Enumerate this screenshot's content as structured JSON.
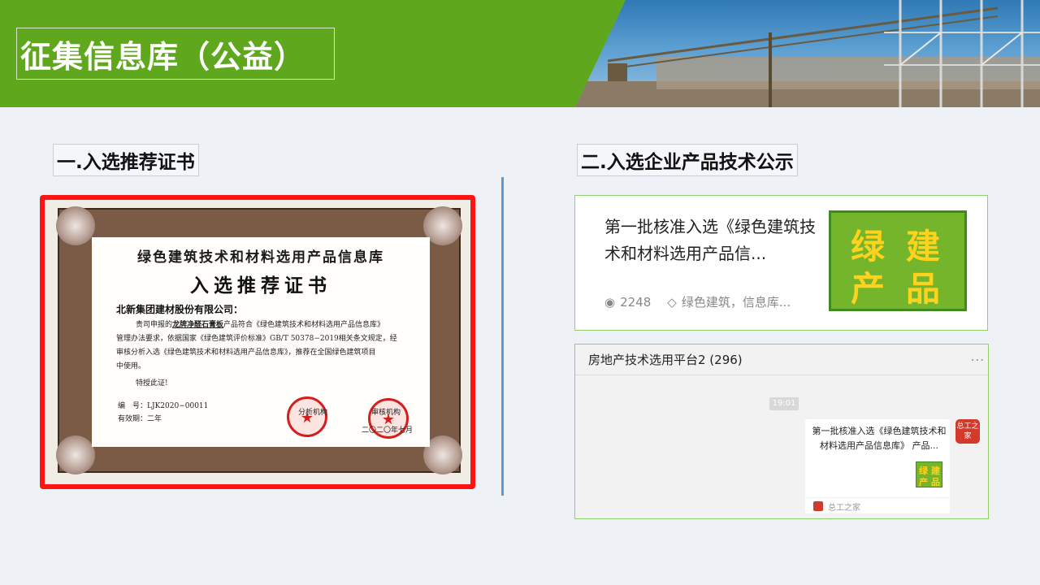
{
  "page": {
    "title": "征集信息库（公益）"
  },
  "sections": {
    "left_label": "一.入选推荐证书",
    "right_label": "二.入选企业产品技术公示"
  },
  "certificate": {
    "heading": "绿色建筑技术和材料选用产品信息库",
    "subheading": "入选推荐证书",
    "addressee": "北新集团建材股份有限公司：",
    "body_prefix": "贵司申报的",
    "product": "龙牌净醛石膏板",
    "body_line1_suffix": "产品符合《绿色建筑技术和材料选用产品信息库》",
    "body_line2": "管理办法要求，依据国家《绿色建筑评价标准》GB/T 50378−2019相关条文规定，经",
    "body_line3": "审核分析入选《绿色建筑技术和材料选用产品信息库》，推荐在全国绿色建筑项目",
    "body_line4": "中使用。",
    "authorization": "特授此证!",
    "number": "编　号：LJK2020−00011",
    "validity": "有效期：二年",
    "seal1_label": "分析机构",
    "seal2_label": "审核机构",
    "date": "二〇二〇年七月"
  },
  "article_card": {
    "title": "第一批核准入选《绿色建筑技术和材料选用产品信...",
    "views": "2248",
    "tags": "绿色建筑，信息库...",
    "thumb_chars": [
      "绿",
      "建",
      "产",
      "品"
    ]
  },
  "chat": {
    "group_title": "房地产技术选用平台2 (296)",
    "more": "...",
    "time": "19:01",
    "message_text": "第一批核准入选《绿色建筑技术和材料选用产品信息库》 产品...",
    "message_thumb_chars": [
      "绿",
      "建",
      "产",
      "品"
    ],
    "source": "总工之家",
    "avatar_text": "总工之家"
  },
  "colors": {
    "header_green": "#5fa81e",
    "frame_red": "#ff1414",
    "card_border": "#8fd06a",
    "divider_blue": "#5b9bd5"
  }
}
